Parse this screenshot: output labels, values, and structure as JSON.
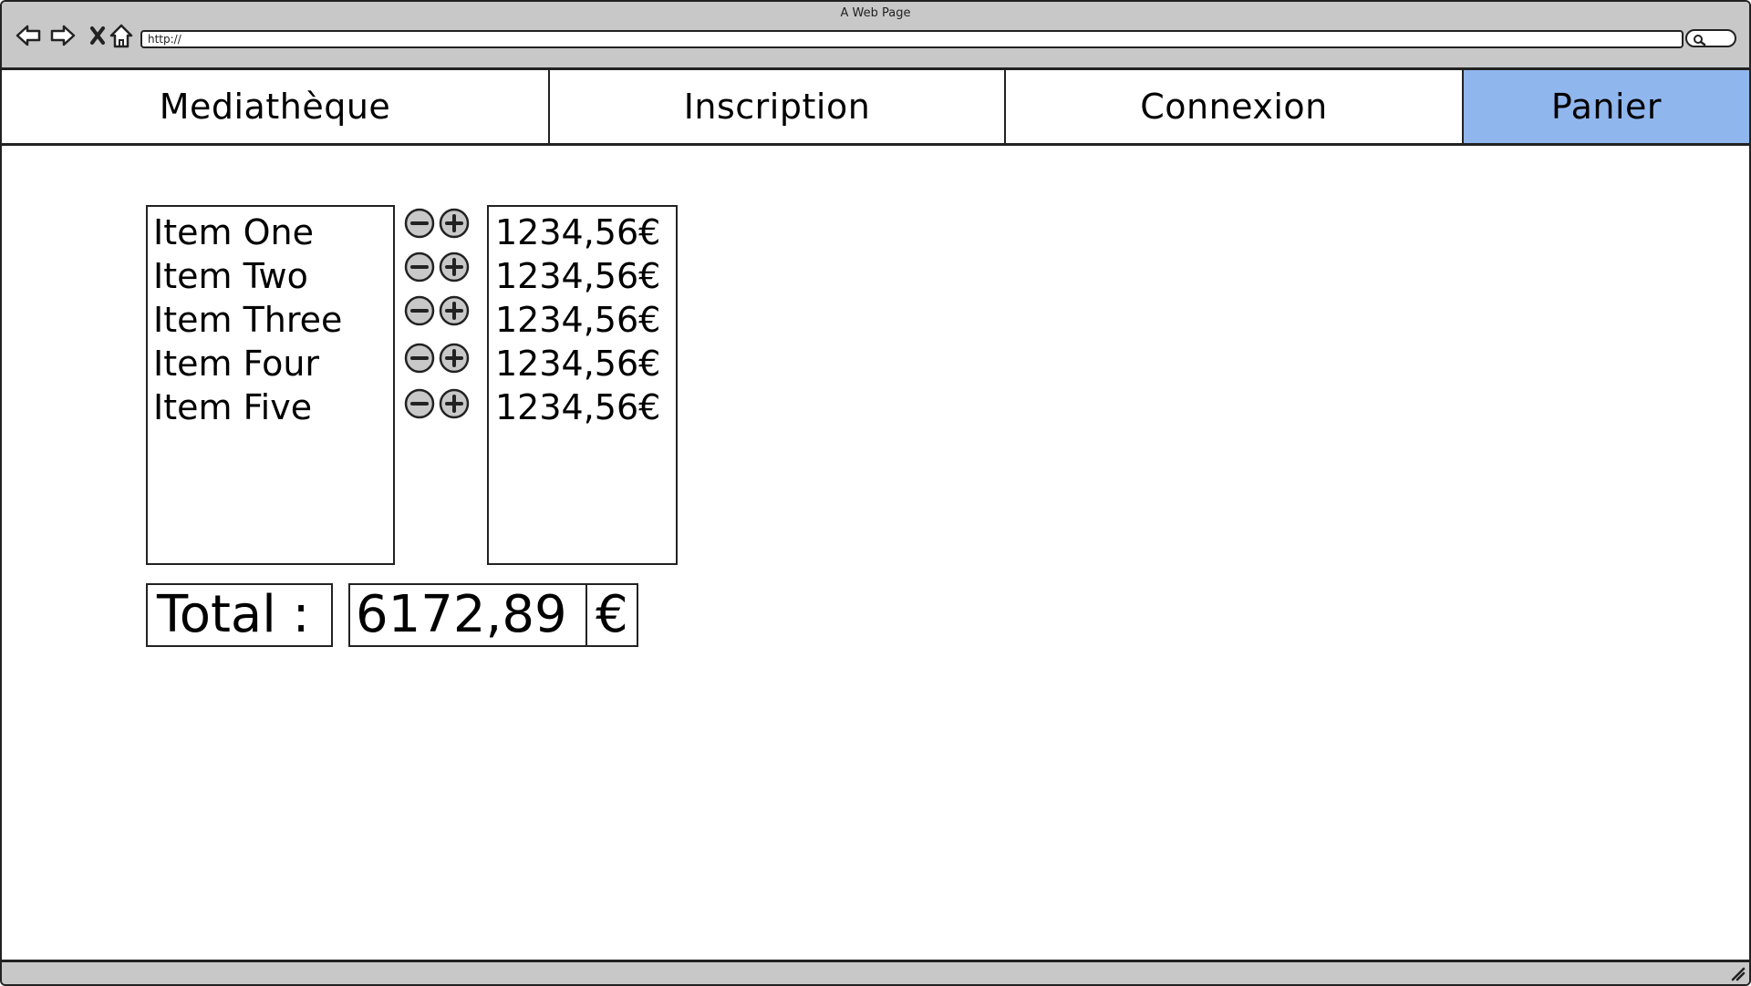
{
  "browser": {
    "window_title": "A Web Page",
    "url": "http://",
    "icons": {
      "back": "back-arrow-icon",
      "forward": "forward-arrow-icon",
      "stop": "close-icon",
      "home": "home-icon",
      "search": "search-icon",
      "resize": "resize-grip-icon"
    }
  },
  "tabs": [
    {
      "label": "Mediathèque",
      "active": false
    },
    {
      "label": "Inscription",
      "active": false
    },
    {
      "label": "Connexion",
      "active": false
    },
    {
      "label": "Panier",
      "active": true
    }
  ],
  "cart": {
    "items": [
      {
        "name": "Item One",
        "price": "1234,56€"
      },
      {
        "name": "Item Two",
        "price": "1234,56€"
      },
      {
        "name": "Item Three",
        "price": "1234,56€"
      },
      {
        "name": "Item Four",
        "price": "1234,56€"
      },
      {
        "name": "Item Five",
        "price": "1234,56€"
      }
    ],
    "total_label": "Total :",
    "total_value": "6172,89",
    "currency": "€"
  },
  "colors": {
    "active_tab": "#90b6ee",
    "chrome": "#c8c8c8",
    "outline": "#222222",
    "button_fill": "#c8c8c8"
  }
}
